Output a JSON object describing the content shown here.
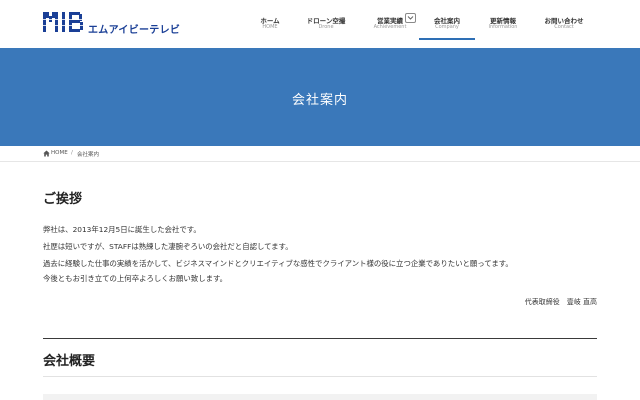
{
  "header": {
    "logo_text": "エムアイビーテレビ",
    "nav": [
      {
        "jp": "ホーム",
        "en": "HOME"
      },
      {
        "jp": "ドローン空撮",
        "en": "Drone"
      },
      {
        "jp": "営業実績",
        "en": "Achievement"
      },
      {
        "jp": "会社案内",
        "en": "Company"
      },
      {
        "jp": "更新情報",
        "en": "Information"
      },
      {
        "jp": "お問い合わせ",
        "en": "Contact"
      }
    ],
    "active_item": "Company"
  },
  "banner": {
    "title": "会社案内"
  },
  "breadcrumb": {
    "home": "HOME",
    "separator": "/",
    "current": "会社案内"
  },
  "greeting": {
    "title": "ご挨拶",
    "lines": [
      "弊社は、2013年12月5日に誕生した会社です。",
      "社歴は短いですが、STAFFは熟練した凄腕ぞろいの会社だと自認してます。",
      "過去に経験した仕事の実績を活かして、ビジネスマインドとクリエイティブな感性でクライアント様の役に立つ企業でありたいと願ってます。",
      "今後ともお引き立ての上何卒よろしくお願い致します。"
    ],
    "signature": "代表取締役　壹岐 直高"
  },
  "overview": {
    "title": "会社概要"
  },
  "colors": {
    "brand": "#1a3f96",
    "banner": "#3a78ba",
    "accent_underline": "#2e6fb5"
  },
  "icons": {
    "breadcrumb_home": "home-icon",
    "dropdown": "chevron-down-icon"
  }
}
